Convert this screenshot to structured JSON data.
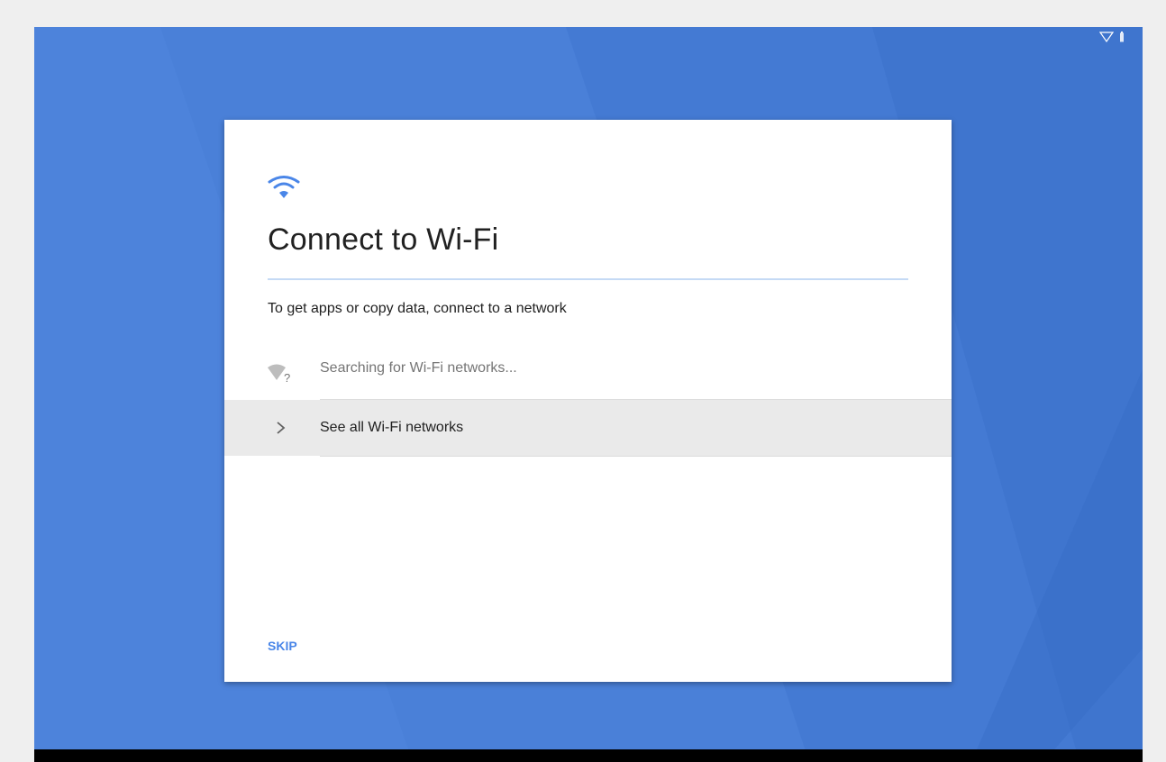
{
  "colors": {
    "wallpaper": "#4a80d8",
    "accent": "#4a86e8",
    "title_divider": "#c5daf5",
    "highlight_row": "#eaeaea"
  },
  "status_bar": {
    "icons": [
      "wifi-icon",
      "battery-icon"
    ]
  },
  "card": {
    "header_icon": "wifi-icon",
    "title": "Connect to Wi-Fi",
    "subtitle": "To get apps or copy data, connect to a network",
    "searching": {
      "icon": "wifi-unknown-icon",
      "text": "Searching for Wi-Fi networks..."
    },
    "see_all": {
      "icon": "chevron-right-icon",
      "label": "See all Wi-Fi networks"
    },
    "skip_label": "SKIP"
  }
}
